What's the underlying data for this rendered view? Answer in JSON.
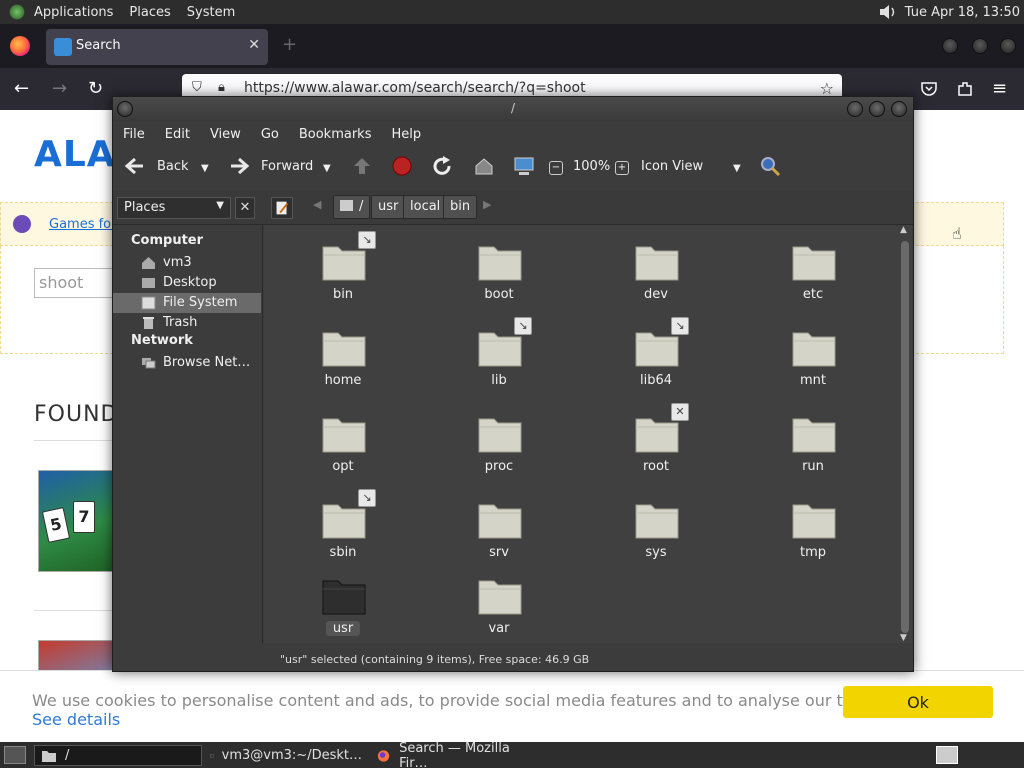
{
  "top_panel": {
    "menus": [
      "Applications",
      "Places",
      "System"
    ],
    "clock": "Tue Apr 18, 13:50"
  },
  "firefox": {
    "tab_title": "Search",
    "url": "https://www.alawar.com/search/search/?q=shoot"
  },
  "webpage": {
    "logo_text": "ALA",
    "games_link": "Games for",
    "search_value": "shoot",
    "found_heading": "FOUND",
    "thumb_cards": [
      "5",
      "7"
    ]
  },
  "cookie": {
    "text": "We use cookies to personalise content and ads, to provide social media features and to analyse our traffic.",
    "link": "See details",
    "ok_label": "Ok"
  },
  "caja": {
    "title": "/",
    "menus": [
      "File",
      "Edit",
      "View",
      "Go",
      "Bookmarks",
      "Help"
    ],
    "toolbar": {
      "back_label": "Back",
      "forward_label": "Forward",
      "zoom_level": "100%",
      "view_mode": "Icon View"
    },
    "places_label": "Places",
    "breadcrumbs": [
      "/",
      "usr",
      "local",
      "bin"
    ],
    "sidebar": {
      "computer_heading": "Computer",
      "network_heading": "Network",
      "items": [
        {
          "label": "vm3"
        },
        {
          "label": "Desktop"
        },
        {
          "label": "File System"
        },
        {
          "label": "Trash"
        },
        {
          "label": "Browse Net…"
        }
      ]
    },
    "folders": [
      {
        "name": "bin",
        "emblem": "↘"
      },
      {
        "name": "boot",
        "emblem": ""
      },
      {
        "name": "dev",
        "emblem": ""
      },
      {
        "name": "etc",
        "emblem": ""
      },
      {
        "name": "home",
        "emblem": ""
      },
      {
        "name": "lib",
        "emblem": "↘"
      },
      {
        "name": "lib64",
        "emblem": "↘"
      },
      {
        "name": "mnt",
        "emblem": ""
      },
      {
        "name": "opt",
        "emblem": ""
      },
      {
        "name": "proc",
        "emblem": ""
      },
      {
        "name": "root",
        "emblem": "✕"
      },
      {
        "name": "run",
        "emblem": ""
      },
      {
        "name": "sbin",
        "emblem": "↘"
      },
      {
        "name": "srv",
        "emblem": ""
      },
      {
        "name": "sys",
        "emblem": ""
      },
      {
        "name": "tmp",
        "emblem": ""
      },
      {
        "name": "usr",
        "emblem": ""
      },
      {
        "name": "var",
        "emblem": ""
      }
    ],
    "status": "\"usr\" selected (containing 9 items), Free space: 46.9 GB"
  },
  "taskbar": {
    "files": "/",
    "terminal": "vm3@vm3:~/Deskt…",
    "firefox": "Search — Mozilla Fir…"
  },
  "colors": {
    "folder": "#d4d4c8",
    "folder_selected": "#2e2e2e",
    "accent_yellow": "#f2d500",
    "link_blue": "#2e7bd6"
  }
}
